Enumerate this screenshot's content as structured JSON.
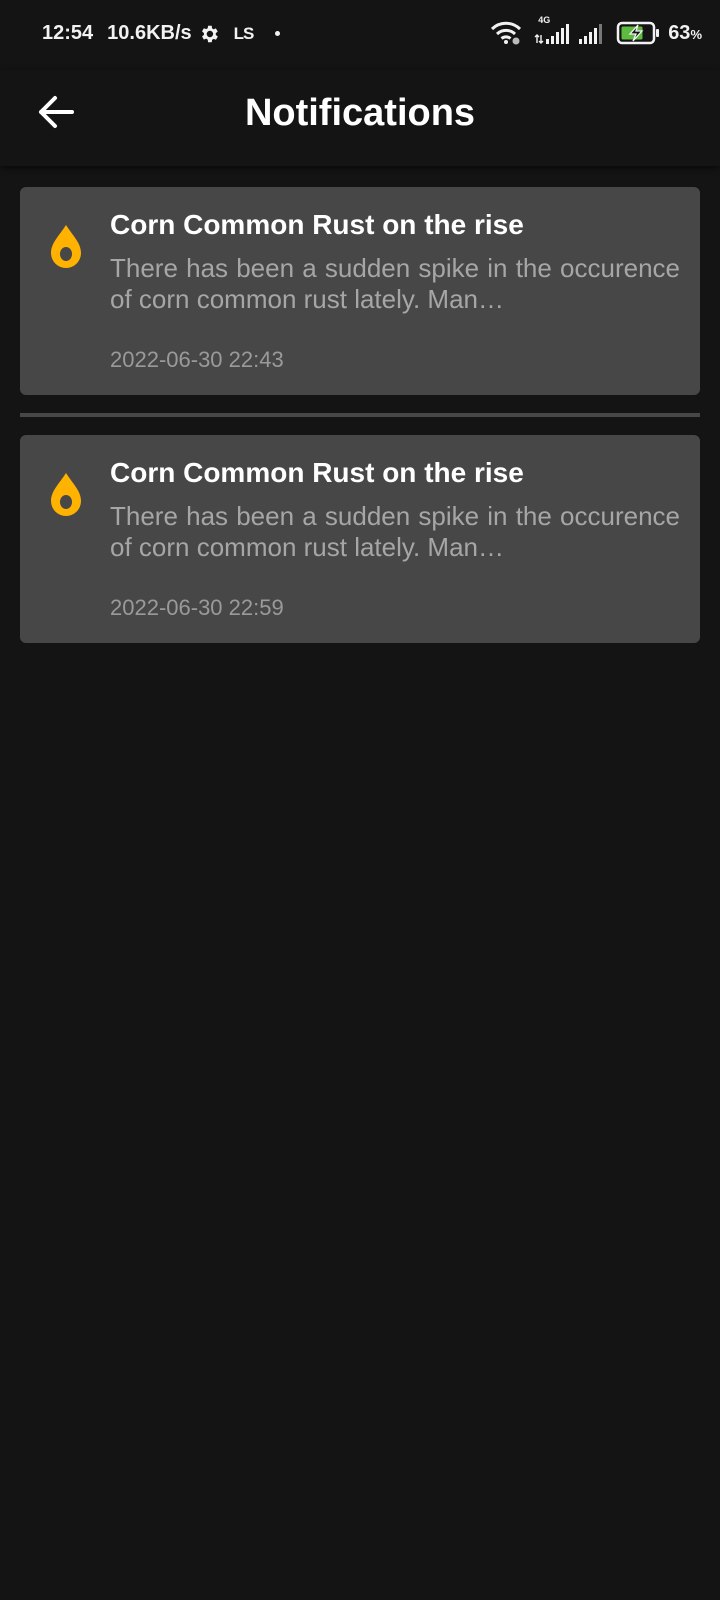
{
  "status_bar": {
    "time": "12:54",
    "net_speed": "10.6KB/s",
    "carrier_glyph": "LS",
    "network_type": "4G",
    "battery_percent": "63",
    "battery_unit": "%",
    "icons": [
      "settings-gear-icon",
      "wifi-icon",
      "signal-icon",
      "battery-charging-icon"
    ]
  },
  "app_bar": {
    "title": "Notifications",
    "back_icon": "arrow-left-icon"
  },
  "notifications": [
    {
      "icon": "drop-icon",
      "icon_color": "#FFB300",
      "title": "Corn Common Rust on the rise",
      "body": "There has been a sudden spike in the occurence of corn common rust lately. Man…",
      "timestamp": "2022-06-30 22:43"
    },
    {
      "icon": "drop-icon",
      "icon_color": "#FFB300",
      "title": "Corn Common Rust on the rise",
      "body": "There has been a sudden spike in the occurence of corn common rust lately. Man…",
      "timestamp": "2022-06-30 22:59"
    }
  ],
  "colors": {
    "background": "#141414",
    "card": "#474747",
    "accent": "#FFB300",
    "battery_fill": "#5DBB3F"
  }
}
